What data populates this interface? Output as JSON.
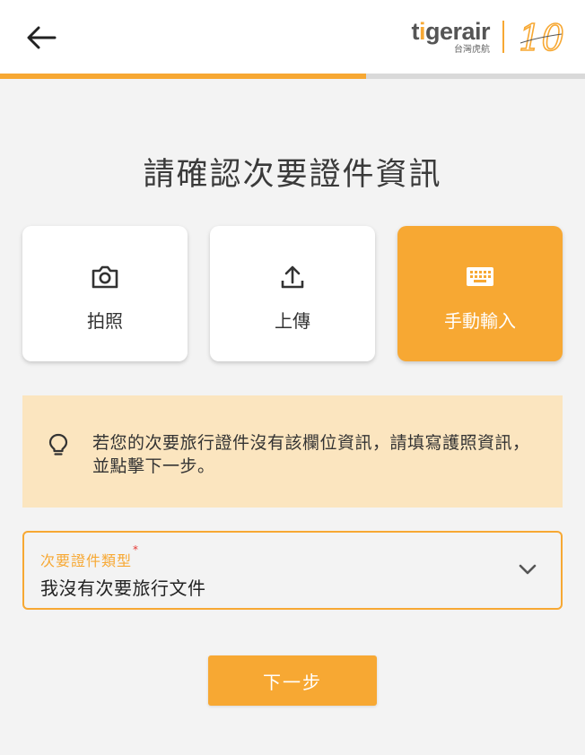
{
  "header": {
    "back_icon": "arrow-left-icon",
    "logo": {
      "name": "tigerair",
      "subtitle": "台灣虎航",
      "anniversary": "10"
    }
  },
  "progress": {
    "fraction": 0.625,
    "color": "#f7a833"
  },
  "page": {
    "title": "請確認次要證件資訊"
  },
  "methods": [
    {
      "label": "拍照",
      "icon": "camera-icon",
      "active": false
    },
    {
      "label": "上傳",
      "icon": "upload-icon",
      "active": false
    },
    {
      "label": "手動輸入",
      "icon": "keyboard-icon",
      "active": true
    }
  ],
  "notice": {
    "icon": "lightbulb-icon",
    "text": "若您的次要旅行證件沒有該欄位資訊，請填寫護照資訊，並點擊下一步。"
  },
  "document_type": {
    "label": "次要證件類型",
    "required_mark": "*",
    "value": "我沒有次要旅行文件"
  },
  "next_button": {
    "label": "下一步"
  },
  "colors": {
    "accent": "#f7a833",
    "notice_bg": "#fbe5bf",
    "page_bg": "#f3f3f3"
  }
}
